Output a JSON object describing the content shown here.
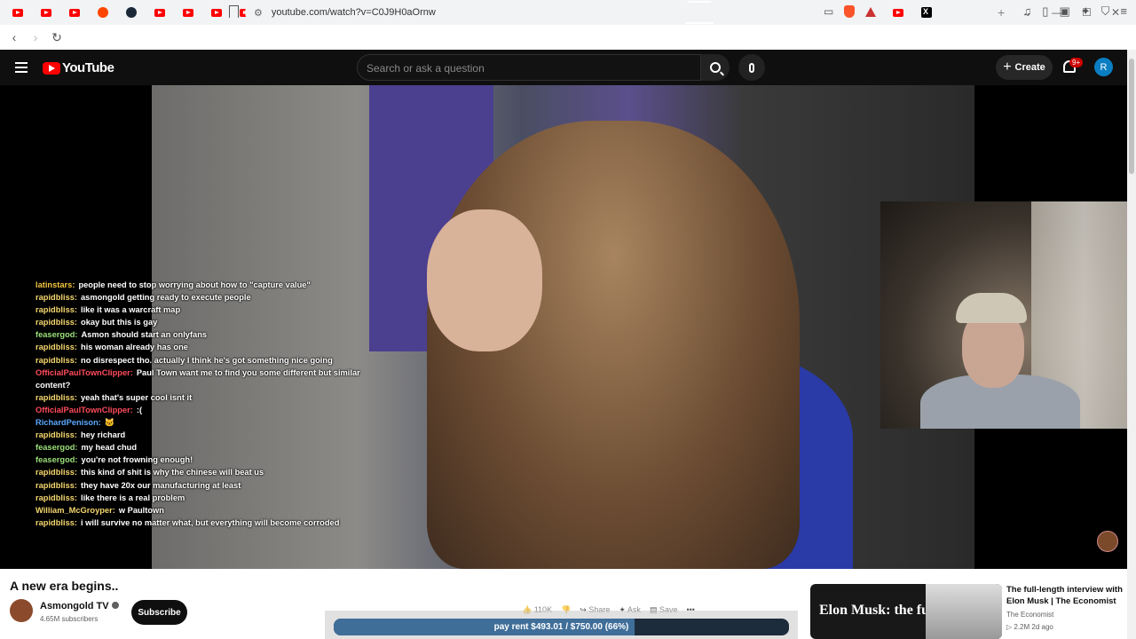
{
  "browser": {
    "tabs": [
      "yt",
      "yt",
      "yt",
      "reddit",
      "steam",
      "yt",
      "yt",
      "yt",
      "yt",
      "yt",
      "yt",
      "yt",
      "yt",
      "yt",
      "yt",
      "yt",
      "yt",
      "yt",
      "yt",
      "star",
      "yt",
      "steam",
      "x",
      "steam",
      "active",
      "gray",
      "blue",
      "gray",
      "orange",
      "yt",
      "film",
      "yt",
      "x"
    ],
    "url": "youtube.com/watch?v=C0J9H0aOrnw"
  },
  "header": {
    "logo_text": "YouTube",
    "search_placeholder": "Search or ask a question",
    "create_label": "Create",
    "notifications_badge": "9+",
    "avatar_letter": "R"
  },
  "chat": [
    {
      "user": "latinstars",
      "color": "#f4c542",
      "text": "people need to stop worrying about how to \"capture value\""
    },
    {
      "user": "rapidbliss",
      "color": "#f5d76e",
      "text": "asmongold getting ready to execute people"
    },
    {
      "user": "rapidbliss",
      "color": "#f5d76e",
      "text": "like it was a warcraft map"
    },
    {
      "user": "rapidbliss",
      "color": "#f5d76e",
      "text": "okay but this is gay"
    },
    {
      "user": "feasergod",
      "color": "#9be07a",
      "text": "Asmon should start an onlyfans"
    },
    {
      "user": "rapidbliss",
      "color": "#f5d76e",
      "text": "his woman already has one"
    },
    {
      "user": "rapidbliss",
      "color": "#f5d76e",
      "text": "no disrespect tho. actually I think he's got something nice going"
    },
    {
      "user": "OfficialPaulTownClipper",
      "color": "#ff4b5c",
      "text": "Paul Town want me to find you some different but similar content?"
    },
    {
      "user": "rapidbliss",
      "color": "#f5d76e",
      "text": "yeah that's super cool isnt it"
    },
    {
      "user": "OfficialPaulTownClipper",
      "color": "#ff4b5c",
      "text": ":("
    },
    {
      "user": "RichardPenison",
      "color": "#5aa9ff",
      "text": "🐱"
    },
    {
      "user": "rapidbliss",
      "color": "#f5d76e",
      "text": "hey richard"
    },
    {
      "user": "feasergod",
      "color": "#9be07a",
      "text": "my head chud"
    },
    {
      "user": "feasergod",
      "color": "#9be07a",
      "text": "you're not frowning enough!"
    },
    {
      "user": "rapidbliss",
      "color": "#f5d76e",
      "text": "this kind of shit is why the chinese will beat us"
    },
    {
      "user": "rapidbliss",
      "color": "#f5d76e",
      "text": "they have 20x our manufacturing at least"
    },
    {
      "user": "rapidbliss",
      "color": "#f5d76e",
      "text": "like there is a real problem"
    },
    {
      "user": "William_McGroyper",
      "color": "#f5d76e",
      "text": "w Paultown"
    },
    {
      "user": "rapidbliss",
      "color": "#f5d76e",
      "text": "i will survive no matter what, but everything will become corroded"
    }
  ],
  "video": {
    "title": "A new era begins..",
    "channel": "Asmongold TV",
    "subscribers": "4.65M subscribers",
    "subscribe_label": "Subscribe"
  },
  "actions": {
    "likes": "110K",
    "share": "Share",
    "ask": "Ask",
    "save": "Save"
  },
  "overlay": {
    "text": "pay rent $493.01 / $750.00 (66%)",
    "progress": 0.66
  },
  "recommendation": {
    "thumb_text": "Elon Musk: the full-length",
    "title": "The full-length interview with Elon Musk | The Economist",
    "channel": "The Economist",
    "meta": "▷ 2.2M   2d ago"
  }
}
